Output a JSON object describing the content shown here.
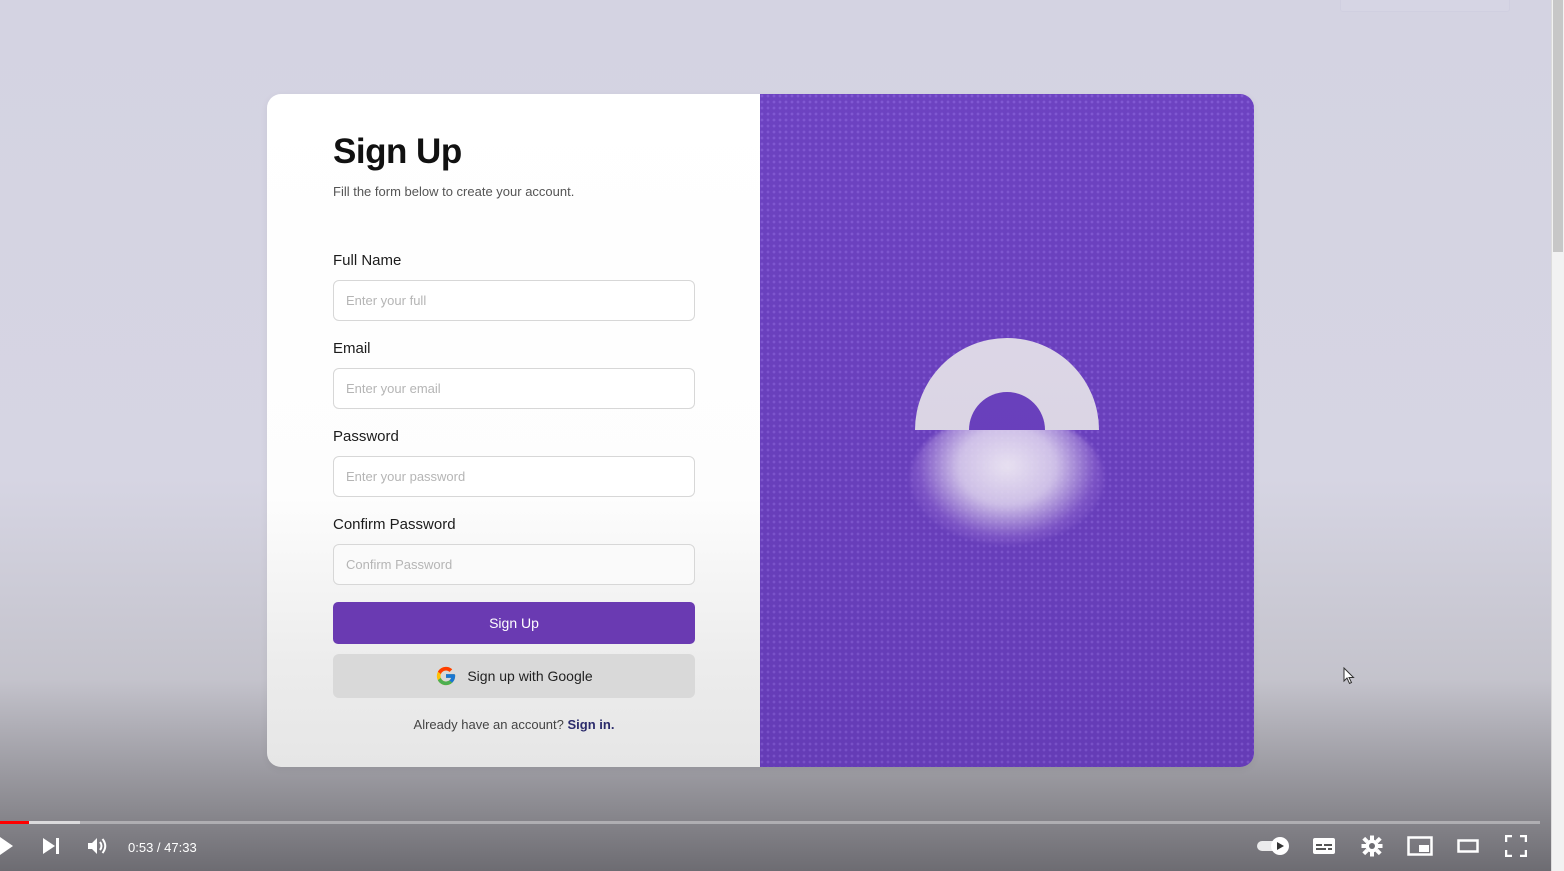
{
  "form": {
    "title": "Sign Up",
    "subtitle": "Fill the form below to create your account.",
    "fields": [
      {
        "label": "Full Name",
        "placeholder": "Enter your full"
      },
      {
        "label": "Email",
        "placeholder": "Enter your email"
      },
      {
        "label": "Password",
        "placeholder": "Enter your password"
      },
      {
        "label": "Confirm Password",
        "placeholder": "Confirm Password"
      }
    ],
    "submit_label": "Sign Up",
    "google_label": "Sign up with Google",
    "signin_prompt": "Already have an account?",
    "signin_link": "Sign in."
  },
  "art": {
    "panel_color": "#6a3fc0",
    "icon": "lock-icon"
  },
  "player": {
    "current_time": "0:53",
    "duration": "47:33",
    "time_text": "0:53 / 47:33",
    "played_fraction": 0.0187,
    "buffered_fraction": 0.052,
    "accent_color": "#ff0000",
    "icons": {
      "play": "play-icon",
      "next": "next-icon",
      "volume": "volume-icon",
      "autoplay": "autoplay-toggle-icon",
      "subtitles": "subtitles-icon",
      "settings": "gear-icon",
      "miniplayer": "miniplayer-icon",
      "theater": "theater-mode-icon",
      "fullscreen": "fullscreen-icon"
    }
  },
  "colors": {
    "primary": "#6a3ab2",
    "background": "#d4d3e2"
  }
}
